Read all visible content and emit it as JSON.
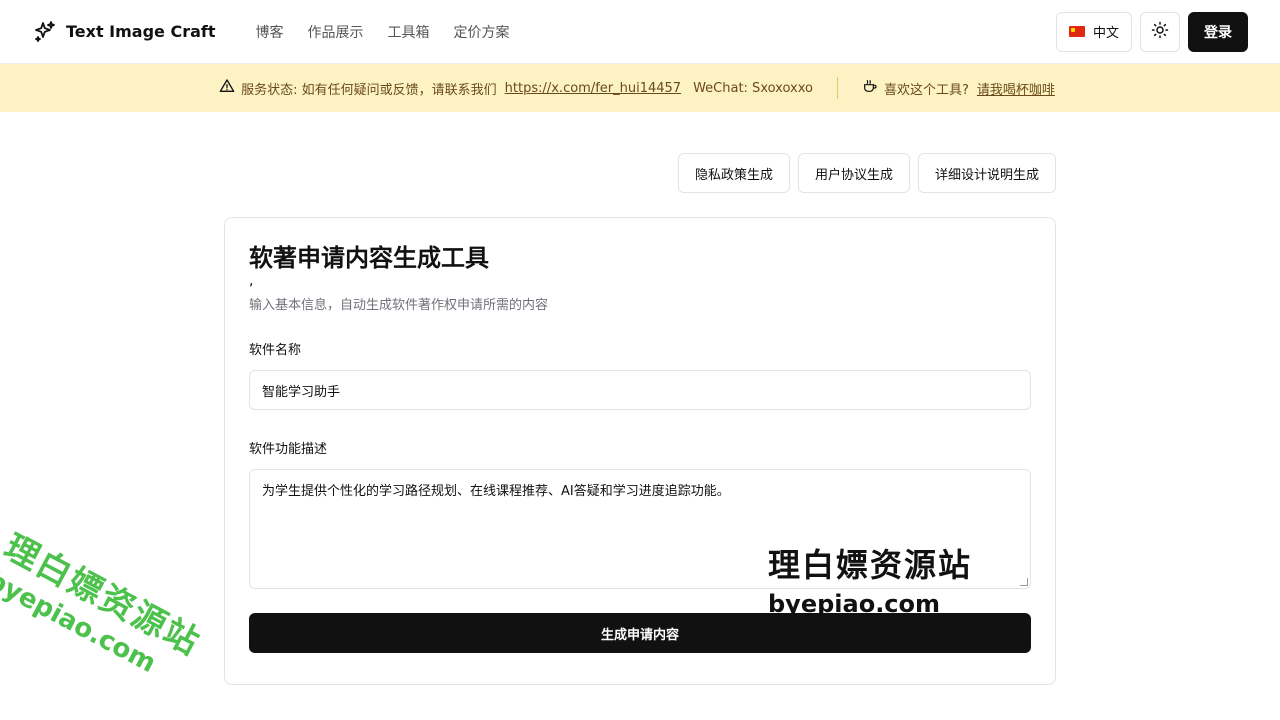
{
  "header": {
    "brand": "Text Image Craft",
    "nav": [
      "博客",
      "作品展示",
      "工具箱",
      "定价方案"
    ],
    "language": "中文",
    "login": "登录"
  },
  "notice": {
    "status_text": "服务状态: 如有任何疑问或反馈，请联系我们",
    "link": "https://x.com/fer_hui14457",
    "wechat": "WeChat: Sxoxoxxo",
    "coffee_text": "喜欢这个工具?",
    "coffee_link": "请我喝杯咖啡"
  },
  "tools": [
    "隐私政策生成",
    "用户协议生成",
    "详细设计说明生成"
  ],
  "card": {
    "title": "软著申请内容生成工具",
    "mark": ",",
    "subtitle": "输入基本信息，自动生成软件著作权申请所需的内容",
    "name_label": "软件名称",
    "name_value": "智能学习助手",
    "desc_label": "软件功能描述",
    "desc_value": "为学生提供个性化的学习路径规划、在线课程推荐、AI答疑和学习进度追踪功能。",
    "submit": "生成申请内容"
  },
  "watermark": {
    "line1": "理白嫖资源站",
    "line2": "byepiao.com"
  },
  "colors": {
    "primary": "#111111",
    "notice_bg": "#fdf2c4",
    "notice_text": "#6b4a1a",
    "watermark_green": "#4cc24c"
  }
}
